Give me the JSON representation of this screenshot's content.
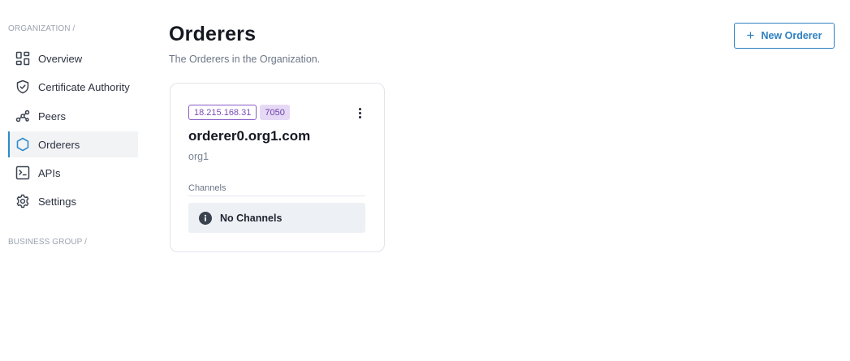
{
  "sidebar": {
    "org_section_label": "ORGANIZATION /",
    "business_section_label": "BUSINESS GROUP /",
    "items": [
      {
        "label": "Overview",
        "icon": "grid-icon"
      },
      {
        "label": "Certificate Authority",
        "icon": "shield-check-icon"
      },
      {
        "label": "Peers",
        "icon": "nodes-icon"
      },
      {
        "label": "Orderers",
        "icon": "hexagon-icon",
        "active": true
      },
      {
        "label": "APIs",
        "icon": "terminal-icon"
      },
      {
        "label": "Settings",
        "icon": "gear-icon"
      }
    ]
  },
  "header": {
    "title": "Orderers",
    "subtitle": "The Orderers in the Organization.",
    "new_button_label": "New Orderer"
  },
  "orderer_card": {
    "ip": "18.215.168.31",
    "port": "7050",
    "name": "orderer0.org1.com",
    "org": "org1",
    "channels_label": "Channels",
    "empty_channels_text": "No Channels"
  },
  "colors": {
    "accent": "#2e7fbf",
    "active_indicator": "#2e8bc9",
    "tag_purple": "#7a4cb8",
    "tag_port_bg": "#e6d9f6",
    "empty_state_bg": "#edf0f4"
  }
}
